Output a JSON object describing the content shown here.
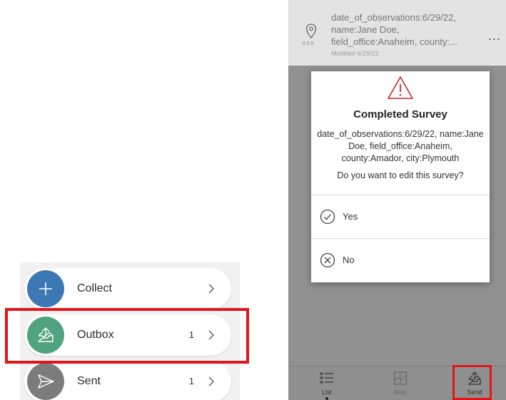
{
  "left_menu": {
    "items": [
      {
        "label": "Collect",
        "count": "",
        "icon": "plus-icon",
        "color": "#3c78b4"
      },
      {
        "label": "Outbox",
        "count": "1",
        "icon": "outbox-tray-icon",
        "color": "#4fa37e"
      },
      {
        "label": "Sent",
        "count": "1",
        "icon": "paper-plane-icon",
        "color": "#7c7c7c"
      }
    ],
    "highlight_color": "#e3151a"
  },
  "record": {
    "line1": "date_of_observations:6/29/22,",
    "line2": "name:Jane Doe,",
    "line3": "field_office:Anaheim, county:...",
    "modified": "Modified 6/29/22",
    "distance": "0.0 ft",
    "more": "..."
  },
  "dialog": {
    "title": "Completed Survey",
    "body": "date_of_observations:6/29/22, name:Jane Doe, field_office:Anaheim, county:Amador, city:Plymouth",
    "question": "Do you want to edit this survey?",
    "options": [
      {
        "label": "Yes",
        "icon": "check-circle-icon"
      },
      {
        "label": "No",
        "icon": "x-circle-icon"
      }
    ]
  },
  "tabbar": {
    "tabs": [
      {
        "label": "List",
        "icon": "list-icon",
        "active": true
      },
      {
        "label": "Map",
        "icon": "map-icon",
        "active": false
      },
      {
        "label": "Send",
        "icon": "send-tray-icon",
        "active": false
      }
    ]
  }
}
